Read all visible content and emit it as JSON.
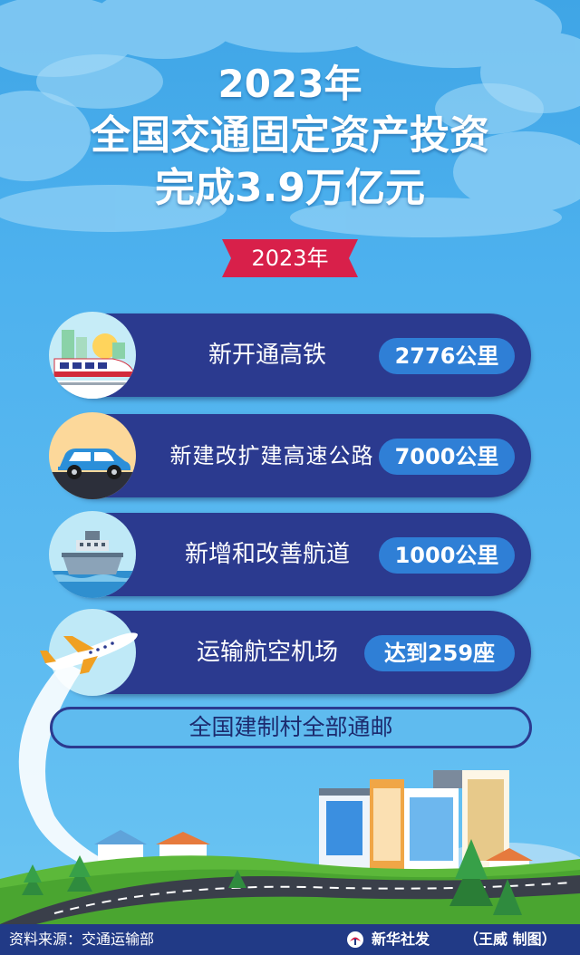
{
  "header": {
    "title_line1": "2023年",
    "title_line2": "全国交通固定资产投资",
    "title_line3": "完成3.9万亿元"
  },
  "year_ribbon": {
    "label": "2023年",
    "color": "#d8204a"
  },
  "items": [
    {
      "label": "新开通高铁",
      "value": "2776公里",
      "icon": "high-speed-train-icon"
    },
    {
      "label": "新建改扩建高速公路",
      "value": "7000公里",
      "icon": "car-icon"
    },
    {
      "label": "新增和改善航道",
      "value": "1000公里",
      "icon": "ship-icon"
    },
    {
      "label": "运输航空机场",
      "value": "达到259座",
      "icon": "airplane-icon"
    }
  ],
  "postal_note": "全国建制村全部通邮",
  "footer": {
    "source": "资料来源：交通运输部",
    "agency": "新华社发",
    "credit": "（王威 制图）"
  },
  "colors": {
    "sky": "#4db1ee",
    "card": "#2b3a8f",
    "value_pill": "#2f7fd6",
    "footer": "#213a86",
    "grass": "#5cb83a"
  }
}
